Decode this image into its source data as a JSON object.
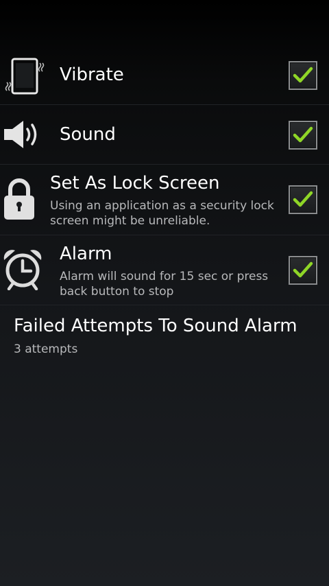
{
  "preferences": {
    "vibrate": {
      "title": "Vibrate",
      "checked": true,
      "icon": "vibrate-phone-icon"
    },
    "sound": {
      "title": "Sound",
      "checked": true,
      "icon": "speaker-icon"
    },
    "lock_screen": {
      "title": "Set As Lock Screen",
      "summary": "Using an application as a security lock screen might be unreliable.",
      "checked": true,
      "icon": "padlock-icon"
    },
    "alarm": {
      "title": "Alarm",
      "summary": "Alarm will sound for 15 sec or press back button to stop",
      "checked": true,
      "icon": "alarm-clock-icon"
    },
    "failed_attempts": {
      "title": "Failed Attempts To Sound Alarm",
      "summary": "3 attempts"
    }
  },
  "colors": {
    "check_green": "#8fd627",
    "checkbox_border": "#8a8c8e",
    "summary_text": "#b8b9bb",
    "divider": "#202327"
  }
}
